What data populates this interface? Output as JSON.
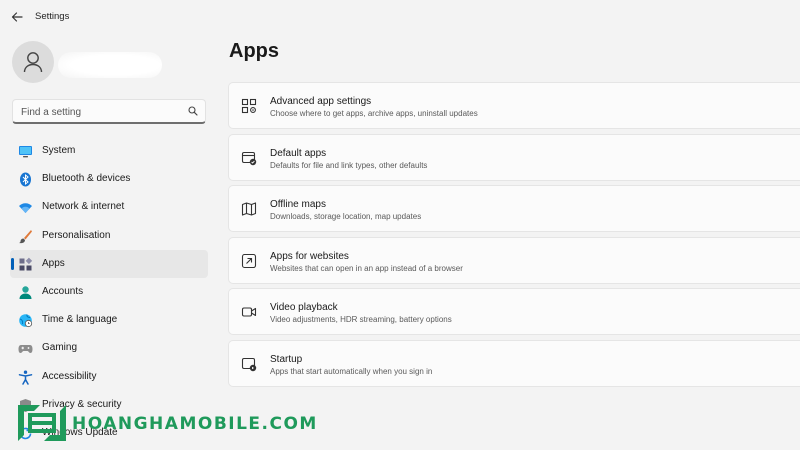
{
  "window": {
    "title": "Settings"
  },
  "search": {
    "placeholder": "Find a setting"
  },
  "sidebar": {
    "items": [
      {
        "label": "System",
        "icon": "monitor-icon"
      },
      {
        "label": "Bluetooth & devices",
        "icon": "bluetooth-icon"
      },
      {
        "label": "Network & internet",
        "icon": "wifi-icon"
      },
      {
        "label": "Personalisation",
        "icon": "paintbrush-icon"
      },
      {
        "label": "Apps",
        "icon": "apps-icon",
        "selected": true
      },
      {
        "label": "Accounts",
        "icon": "person-icon"
      },
      {
        "label": "Time & language",
        "icon": "globe-clock-icon"
      },
      {
        "label": "Gaming",
        "icon": "gamepad-icon"
      },
      {
        "label": "Accessibility",
        "icon": "accessibility-icon"
      },
      {
        "label": "Privacy & security",
        "icon": "shield-icon"
      },
      {
        "label": "Windows Update",
        "icon": "update-icon"
      }
    ]
  },
  "main": {
    "title": "Apps",
    "cards": [
      {
        "title": "Advanced app settings",
        "desc": "Choose where to get apps, archive apps, uninstall updates",
        "icon": "app-settings-icon"
      },
      {
        "title": "Default apps",
        "desc": "Defaults for file and link types, other defaults",
        "icon": "default-apps-icon"
      },
      {
        "title": "Offline maps",
        "desc": "Downloads, storage location, map updates",
        "icon": "map-icon"
      },
      {
        "title": "Apps for websites",
        "desc": "Websites that can open in an app instead of a browser",
        "icon": "open-external-icon"
      },
      {
        "title": "Video playback",
        "desc": "Video adjustments, HDR streaming, battery options",
        "icon": "video-camera-icon"
      },
      {
        "title": "Startup",
        "desc": "Apps that start automatically when you sign in",
        "icon": "startup-icon"
      }
    ]
  },
  "watermark": {
    "text": "HOANGHAMOBILE.COM",
    "color": "#1f9a5b"
  },
  "colors": {
    "accent": "#005fb8",
    "background": "#f3f3f3",
    "card": "#fbfbfb"
  }
}
